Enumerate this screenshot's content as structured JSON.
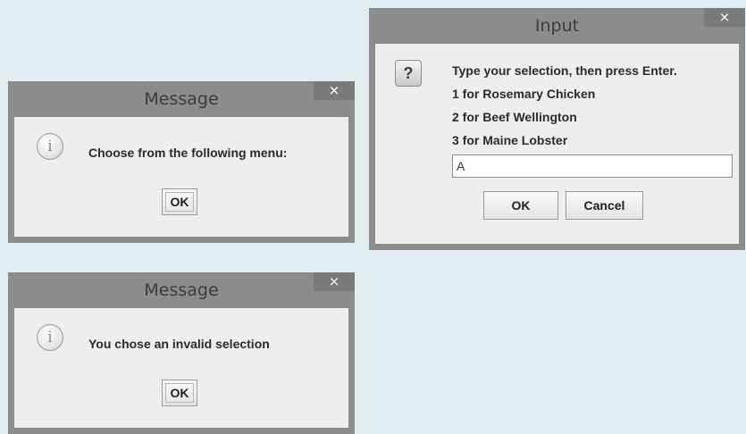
{
  "dialog_message_1": {
    "title": "Message",
    "close_label": "×",
    "icon_glyph": "i",
    "message": "Choose from the following menu:",
    "ok_label": "OK"
  },
  "dialog_input": {
    "title": "Input",
    "close_label": "×",
    "icon_glyph": "?",
    "lines": [
      {
        "num": "",
        "text": "Type your selection, then press Enter."
      },
      {
        "num": "1",
        "text": " for Rosemary Chicken"
      },
      {
        "num": "2",
        "text": " for Beef Wellington"
      },
      {
        "num": "3",
        "text": " for Maine Lobster"
      }
    ],
    "input_value": "A",
    "ok_label": "OK",
    "cancel_label": "Cancel"
  },
  "dialog_message_2": {
    "title": "Message",
    "close_label": "×",
    "icon_glyph": "i",
    "message": "You chose an invalid selection",
    "ok_label": "OK"
  },
  "colors": {
    "background": "#e2eff2",
    "title_bar": "#8c8c8c",
    "close_button": "#7a7a7a",
    "content": "#eeeeee"
  }
}
